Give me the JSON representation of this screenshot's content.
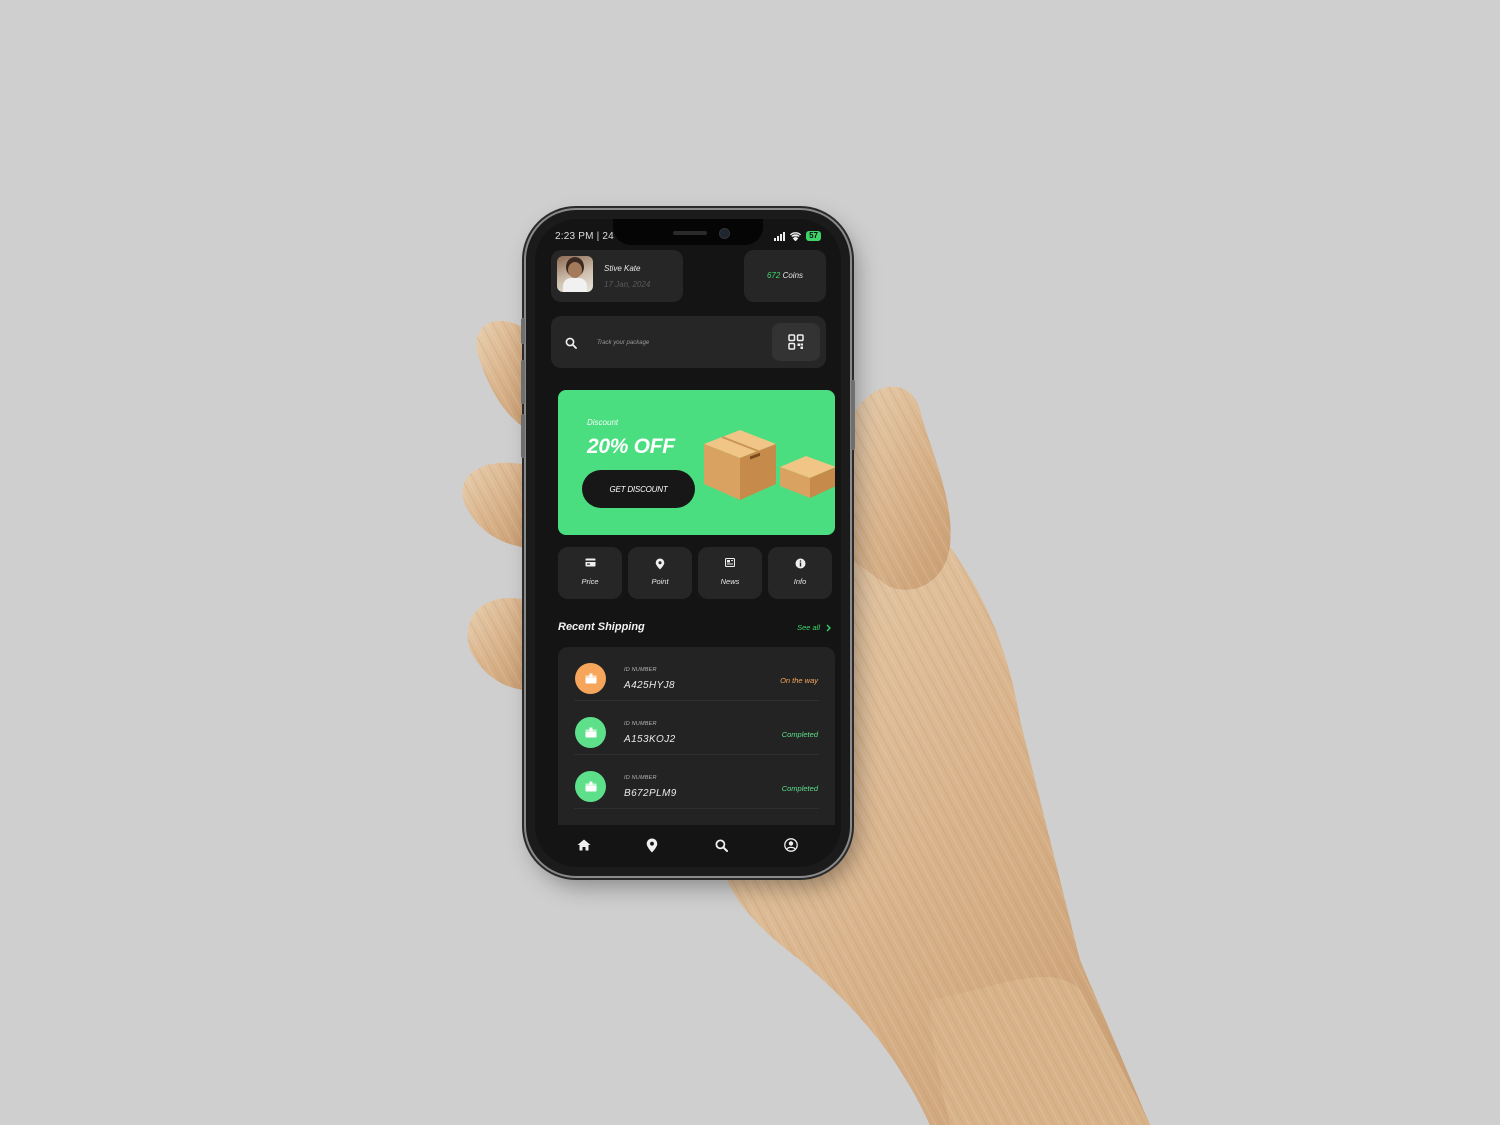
{
  "status_bar": {
    "time": "2:23 PM | 24",
    "battery": "57"
  },
  "user": {
    "name": "Stive Kate",
    "date": "17 Jan, 2024"
  },
  "coins": {
    "amount": "672",
    "label": "Coins"
  },
  "search": {
    "placeholder": "Track your package"
  },
  "banner": {
    "label": "Discount",
    "headline": "20% OFF",
    "button": "GET DISCOUNT",
    "color": "#4ade80"
  },
  "quick_actions": [
    {
      "label": "Price",
      "icon": "price-icon"
    },
    {
      "label": "Point",
      "icon": "location-pin-icon"
    },
    {
      "label": "News",
      "icon": "news-icon"
    },
    {
      "label": "Info",
      "icon": "info-icon"
    }
  ],
  "recent": {
    "title": "Recent Shipping",
    "see_all": "See all",
    "items": [
      {
        "id_label": "ID NUMBER",
        "id": "A425HYJ8",
        "status": "On the way",
        "status_color": "#f5a65b"
      },
      {
        "id_label": "ID NUMBER",
        "id": "A153KOJ2",
        "status": "Completed",
        "status_color": "#5ee08b"
      },
      {
        "id_label": "ID NUMBER",
        "id": "B672PLM9",
        "status": "Completed",
        "status_color": "#5ee08b"
      }
    ]
  },
  "tabs": [
    {
      "icon": "home-icon"
    },
    {
      "icon": "location-pin-icon"
    },
    {
      "icon": "search-icon"
    },
    {
      "icon": "profile-icon"
    }
  ],
  "colors": {
    "accent": "#4ade80",
    "background": "#141414",
    "card": "#262626",
    "backdrop": "#cfcfcf"
  }
}
